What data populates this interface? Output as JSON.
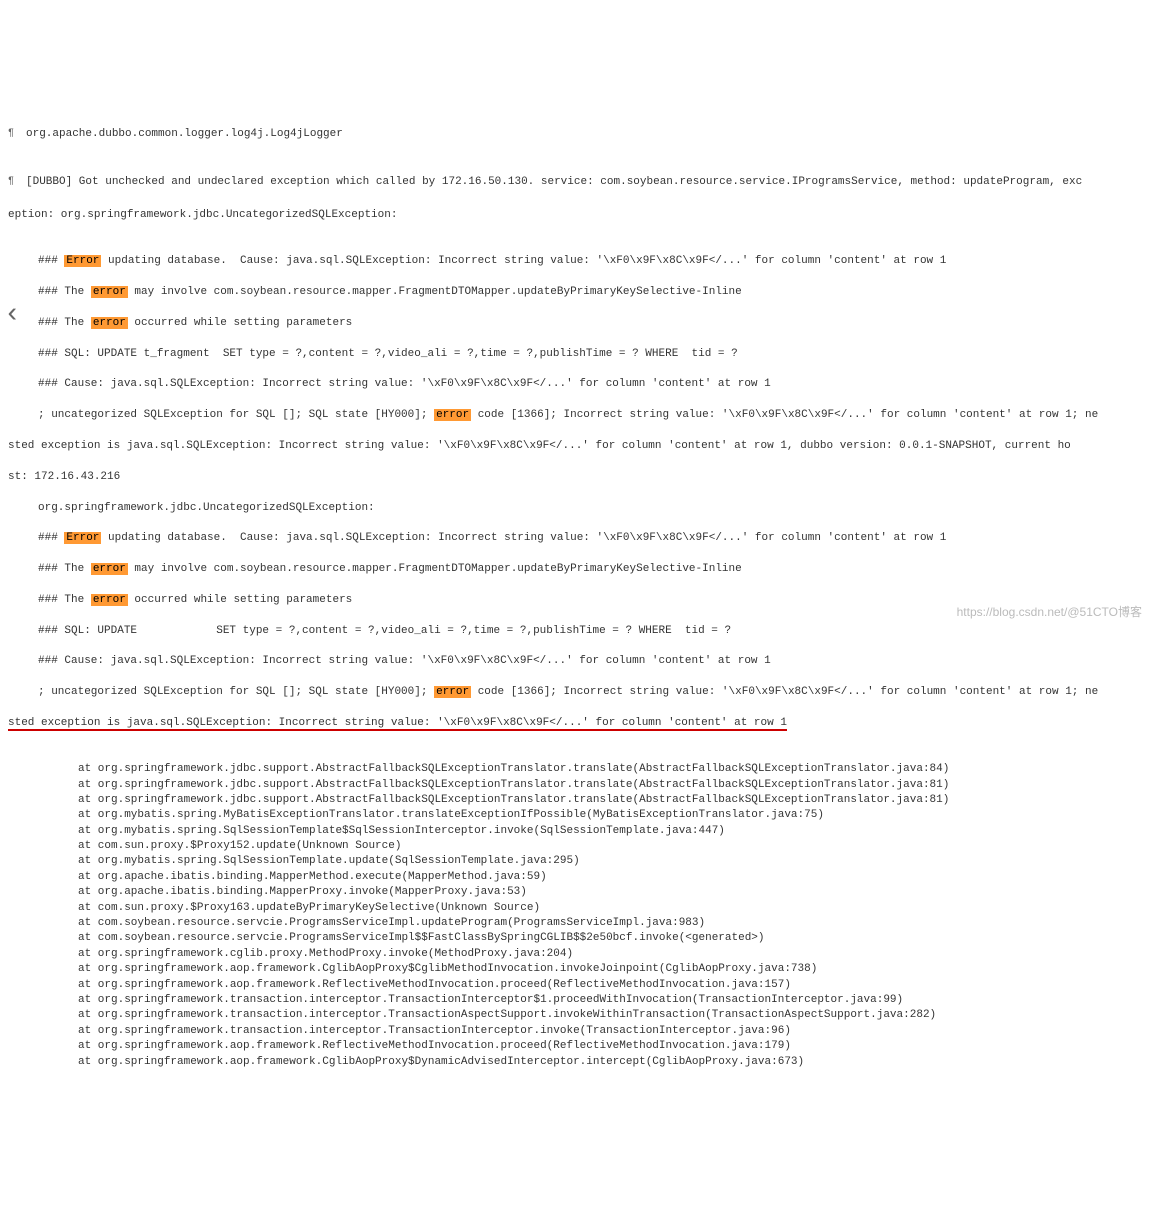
{
  "header1": {
    "class": "org.apache.dubbo.common.logger.log4j.Log4jLogger"
  },
  "header2": {
    "prefix": "[DUBBO] Got unchecked and undeclared exception which called by 172.16.50.130. service: com.soybean.resource.service.IProgramsService, method: updateProgram, exc",
    "continuation": "eption: org.springframework.jdbc.UncategorizedSQLException:"
  },
  "lines": {
    "l1a": "### ",
    "l1b": " updating database.  Cause: java.sql.SQLException: Incorrect string value: '\\xF0\\x9F\\x8C\\x9F</...' for column 'content' at row 1",
    "l2a": "### The ",
    "l2b": " may involve com.soybean.resource.mapper.FragmentDTOMapper.updateByPrimaryKeySelective-Inline",
    "l3a": "### The ",
    "l3b": " occurred while setting parameters",
    "l4": "### SQL: UPDATE t_fragment  SET type = ?,content = ?,video_ali = ?,time = ?,publishTime = ? WHERE  tid = ?",
    "l5": "### Cause: java.sql.SQLException: Incorrect string value: '\\xF0\\x9F\\x8C\\x9F</...' for column 'content' at row 1",
    "l6a": "; uncategorized SQLException for SQL []; SQL state [HY000]; ",
    "l6b": " code [1366]; Incorrect string value: '\\xF0\\x9F\\x8C\\x9F</...' for column 'content' at row 1; ne",
    "l7": "sted exception is java.sql.SQLException: Incorrect string value: '\\xF0\\x9F\\x8C\\x9F</...' for column 'content' at row 1, dubbo version: 0.0.1-SNAPSHOT, current ho",
    "l8": "st: 172.16.43.216",
    "l9": "org.springframework.jdbc.UncategorizedSQLException:",
    "l10a": "### ",
    "l10b": " updating database.  Cause: java.sql.SQLException: Incorrect string value: '\\xF0\\x9F\\x8C\\x9F</...' for column 'content' at row 1",
    "l11a": "### The ",
    "l11b": " may involve com.soybean.resource.mapper.FragmentDTOMapper.updateByPrimaryKeySelective-Inline",
    "l12a": "### The ",
    "l12b": " occurred while setting parameters",
    "l13": "### SQL: UPDATE            SET type = ?,content = ?,video_ali = ?,time = ?,publishTime = ? WHERE  tid = ?",
    "l14": "### Cause: java.sql.SQLException: Incorrect string value: '\\xF0\\x9F\\x8C\\x9F</...' for column 'content' at row 1",
    "l15a": "; uncategorized SQLException for SQL []; SQL state [HY000]; ",
    "l15b": " code [1366]; Incorrect string value: '\\xF0\\x9F\\x8C\\x9F</...' for column 'content' at row 1; ne",
    "l16": "sted exception is java.sql.SQLException: Incorrect string value: '\\xF0\\x9F\\x8C\\x9F</...' for column 'content' at row 1"
  },
  "highlight_error": "Error",
  "highlight_error_lc": "error",
  "stack": [
    "at org.springframework.jdbc.support.AbstractFallbackSQLExceptionTranslator.translate(AbstractFallbackSQLExceptionTranslator.java:84)",
    "at org.springframework.jdbc.support.AbstractFallbackSQLExceptionTranslator.translate(AbstractFallbackSQLExceptionTranslator.java:81)",
    "at org.springframework.jdbc.support.AbstractFallbackSQLExceptionTranslator.translate(AbstractFallbackSQLExceptionTranslator.java:81)",
    "at org.mybatis.spring.MyBatisExceptionTranslator.translateExceptionIfPossible(MyBatisExceptionTranslator.java:75)",
    "at org.mybatis.spring.SqlSessionTemplate$SqlSessionInterceptor.invoke(SqlSessionTemplate.java:447)",
    "at com.sun.proxy.$Proxy152.update(Unknown Source)",
    "at org.mybatis.spring.SqlSessionTemplate.update(SqlSessionTemplate.java:295)",
    "at org.apache.ibatis.binding.MapperMethod.execute(MapperMethod.java:59)",
    "at org.apache.ibatis.binding.MapperProxy.invoke(MapperProxy.java:53)",
    "at com.sun.proxy.$Proxy163.updateByPrimaryKeySelective(Unknown Source)",
    "at com.soybean.resource.servcie.ProgramsServiceImpl.updateProgram(ProgramsServiceImpl.java:983)",
    "at com.soybean.resource.servcie.ProgramsServiceImpl$$FastClassBySpringCGLIB$$2e50bcf.invoke(<generated>)",
    "at org.springframework.cglib.proxy.MethodProxy.invoke(MethodProxy.java:204)",
    "at org.springframework.aop.framework.CglibAopProxy$CglibMethodInvocation.invokeJoinpoint(CglibAopProxy.java:738)",
    "at org.springframework.aop.framework.ReflectiveMethodInvocation.proceed(ReflectiveMethodInvocation.java:157)",
    "at org.springframework.transaction.interceptor.TransactionInterceptor$1.proceedWithInvocation(TransactionInterceptor.java:99)",
    "at org.springframework.transaction.interceptor.TransactionAspectSupport.invokeWithinTransaction(TransactionAspectSupport.java:282)",
    "at org.springframework.transaction.interceptor.TransactionInterceptor.invoke(TransactionInterceptor.java:96)",
    "at org.springframework.aop.framework.ReflectiveMethodInvocation.proceed(ReflectiveMethodInvocation.java:179)",
    "at org.springframework.aop.framework.CglibAopProxy$DynamicAdvisedInterceptor.intercept(CglibAopProxy.java:673)"
  ],
  "watermark": "https://blog.csdn.net/@51CTO博客",
  "back": "‹"
}
